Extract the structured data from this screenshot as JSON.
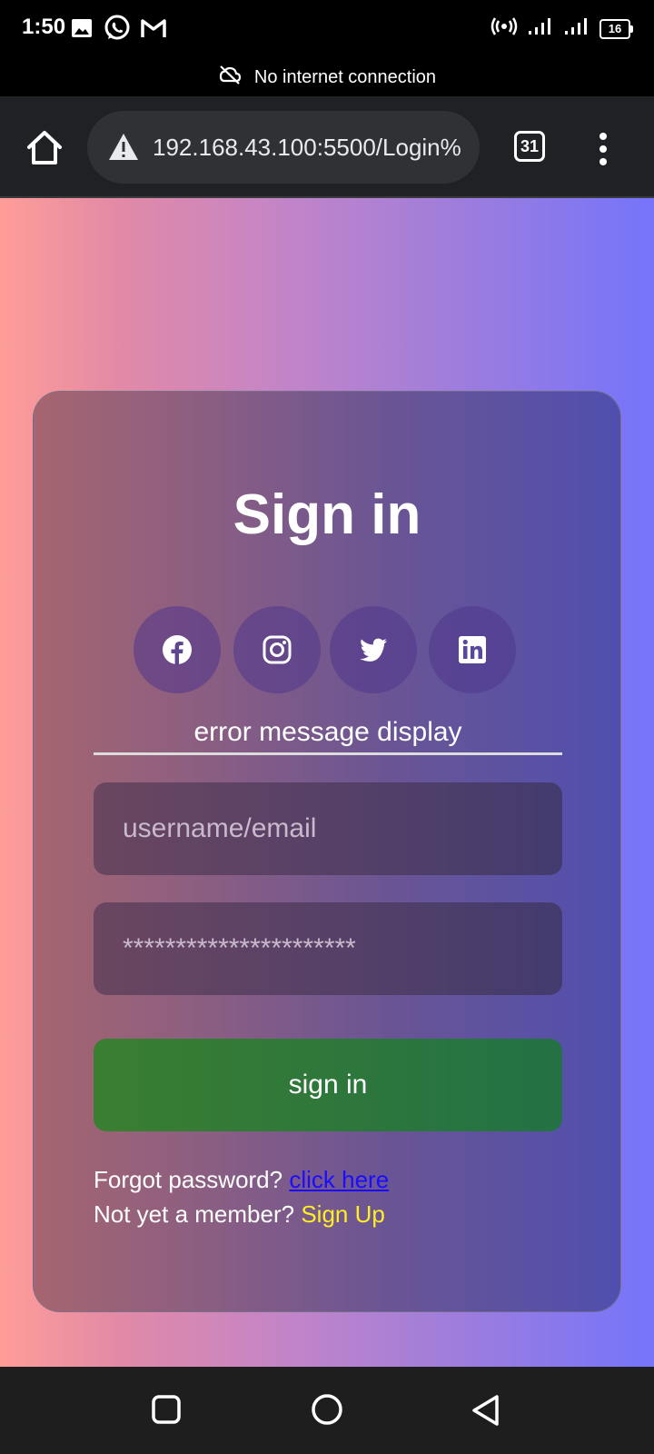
{
  "status_bar": {
    "time": "1:50",
    "notification_icons": [
      "image-icon",
      "whatsapp-icon",
      "gmail-icon"
    ],
    "system_icons": [
      "hotspot-icon",
      "signal-icon",
      "signal-icon"
    ],
    "battery": "16"
  },
  "network_banner": {
    "icon": "cloud-off-icon",
    "text": "No internet connection"
  },
  "browser": {
    "url": "192.168.43.100:5500/Login%",
    "tab_count": "31"
  },
  "login": {
    "title": "Sign in",
    "social_icons": [
      "facebook-icon",
      "instagram-icon",
      "twitter-icon",
      "linkedin-icon"
    ],
    "error_message": "error message display",
    "username_placeholder": "username/email",
    "password_value": "**********************",
    "submit_label": "sign in",
    "forgot_text": "Forgot password?",
    "forgot_link": "click here",
    "member_text": "Not yet a member?",
    "signup_link": "Sign Up"
  },
  "colors": {
    "background_left": "#ff9d98",
    "background_right": "#7574fb",
    "button_green": "#3a7e31",
    "link_blue": "#1a0dff",
    "link_yellow": "#ffee22"
  }
}
